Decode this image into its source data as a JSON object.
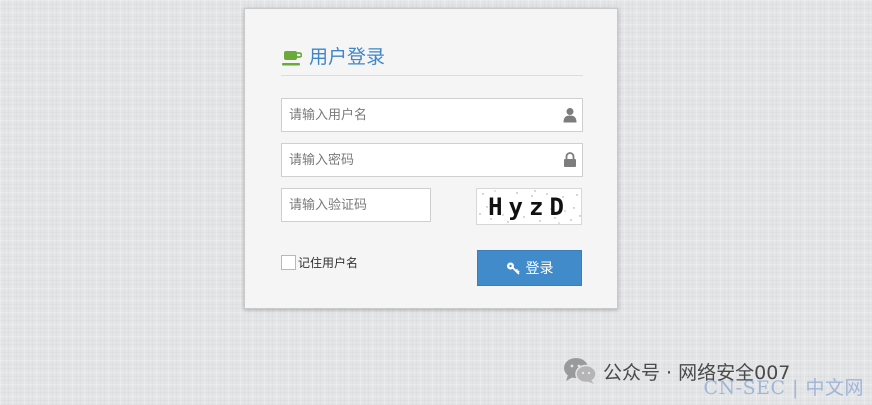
{
  "login": {
    "title": "用户登录",
    "username_placeholder": "请输入用户名",
    "password_placeholder": "请输入密码",
    "captcha_placeholder": "请输入验证码",
    "captcha_text": "HyzD",
    "remember_label": "记住用户名",
    "remember_checked": false,
    "submit_label": "登录"
  },
  "icons": {
    "title": "coffee-cup-icon",
    "username": "user-icon",
    "password": "lock-icon",
    "submit": "key-icon",
    "watermark": "wechat-icon"
  },
  "colors": {
    "accent": "#3f86c9",
    "button": "#428bca",
    "title_icon": "#6aaa3a"
  },
  "watermark": {
    "text": "公众号 · 网络安全007",
    "site": "CN-SEC | 中文网"
  }
}
